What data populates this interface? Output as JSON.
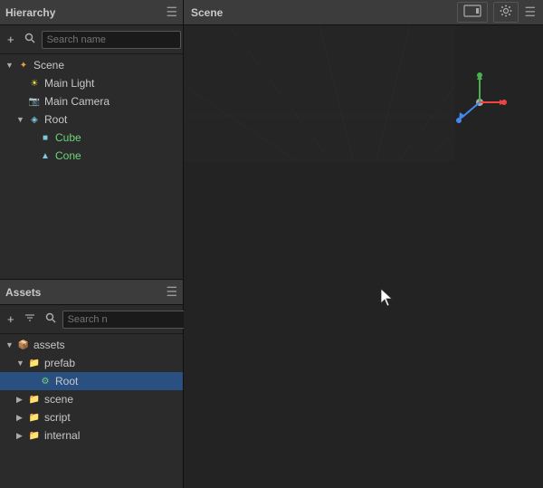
{
  "hierarchy": {
    "title": "Hierarchy",
    "search_placeholder": "Search name",
    "toolbar": {
      "add": "+",
      "search_icon": "🔍",
      "refresh_icon": "↻",
      "collapse_icon": "⇲"
    },
    "tree": [
      {
        "id": "scene",
        "label": "Scene",
        "level": 0,
        "expanded": true,
        "type": "scene",
        "arrow": "▼"
      },
      {
        "id": "main-light",
        "label": "Main Light",
        "level": 1,
        "type": "light",
        "arrow": ""
      },
      {
        "id": "main-camera",
        "label": "Main Camera",
        "level": 1,
        "type": "camera",
        "arrow": ""
      },
      {
        "id": "root",
        "label": "Root",
        "level": 1,
        "expanded": true,
        "type": "gameobject",
        "arrow": "▼"
      },
      {
        "id": "cube",
        "label": "Cube",
        "level": 2,
        "type": "cube",
        "arrow": ""
      },
      {
        "id": "cone",
        "label": "Cone",
        "level": 2,
        "type": "cube",
        "arrow": ""
      }
    ]
  },
  "assets": {
    "title": "Assets",
    "search_placeholder": "Search n",
    "toolbar": {
      "add": "+",
      "filter_icon": "☰",
      "search_icon": "🔍",
      "refresh_icon": "↻",
      "collapse_icon": "⇲"
    },
    "tree": [
      {
        "id": "assets",
        "label": "assets",
        "level": 0,
        "expanded": true,
        "type": "folder-root",
        "arrow": "▼"
      },
      {
        "id": "prefab",
        "label": "prefab",
        "level": 1,
        "expanded": true,
        "type": "folder-blue",
        "arrow": "▼"
      },
      {
        "id": "root-prefab",
        "label": "Root",
        "level": 2,
        "type": "prefab",
        "arrow": "",
        "selected": true
      },
      {
        "id": "scene-folder",
        "label": "scene",
        "level": 1,
        "type": "folder-blue",
        "arrow": "▶"
      },
      {
        "id": "script-folder",
        "label": "script",
        "level": 1,
        "type": "folder-blue",
        "arrow": "▶"
      },
      {
        "id": "internal-folder",
        "label": "internal",
        "level": 1,
        "type": "folder-yellow",
        "arrow": "▶"
      }
    ]
  },
  "scene": {
    "title": "Scene",
    "viewport": {
      "grid_color": "#3a3a3a",
      "background_color": "#232323"
    }
  }
}
